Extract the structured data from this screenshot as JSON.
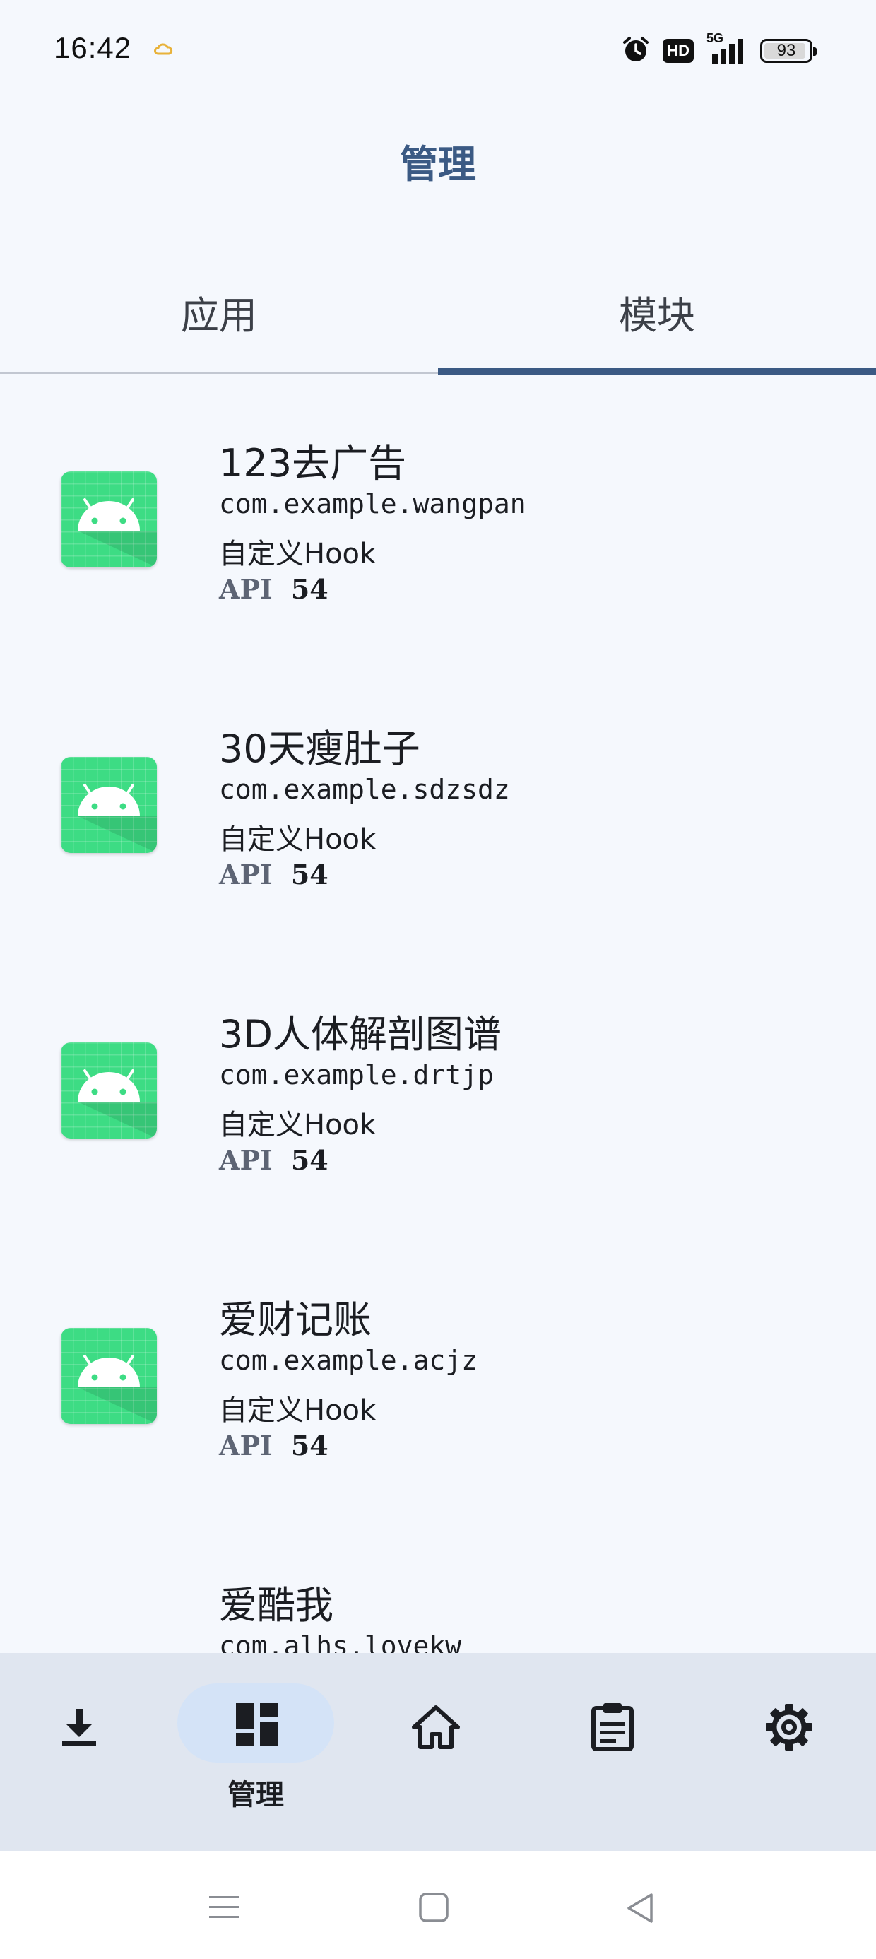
{
  "status_bar": {
    "time": "16:42",
    "hd_label": "HD",
    "network_label": "5G",
    "battery_level": "93",
    "battery_percent": 93
  },
  "header": {
    "title": "管理"
  },
  "tabs": [
    {
      "label": "应用",
      "selected": false
    },
    {
      "label": "模块",
      "selected": true
    }
  ],
  "modules": [
    {
      "name": "123去广告",
      "package": "com.example.wangpan",
      "description": "自定义Hook",
      "api_label": "API",
      "api_value": "54"
    },
    {
      "name": "30天瘦肚子",
      "package": "com.example.sdzsdz",
      "description": "自定义Hook",
      "api_label": "API",
      "api_value": "54"
    },
    {
      "name": "3D人体解剖图谱",
      "package": "com.example.drtjp",
      "description": "自定义Hook",
      "api_label": "API",
      "api_value": "54"
    },
    {
      "name": "爱财记账",
      "package": "com.example.acjz",
      "description": "自定义Hook",
      "api_label": "API",
      "api_value": "54"
    },
    {
      "name": "爱酷我",
      "package": "com.alhs.lovekw"
    }
  ],
  "bottom_nav": {
    "items": [
      {
        "icon": "download-icon",
        "label": ""
      },
      {
        "icon": "dashboard-icon",
        "label": "管理",
        "selected": true
      },
      {
        "icon": "home-icon",
        "label": ""
      },
      {
        "icon": "clipboard-icon",
        "label": ""
      },
      {
        "icon": "gear-icon",
        "label": ""
      }
    ]
  },
  "colors": {
    "accent": "#3b5a84",
    "background": "#f5f8fd",
    "nav_background": "#e0e6f0",
    "nav_pill": "#d4e3f7",
    "android_green": "#3ddc84"
  }
}
